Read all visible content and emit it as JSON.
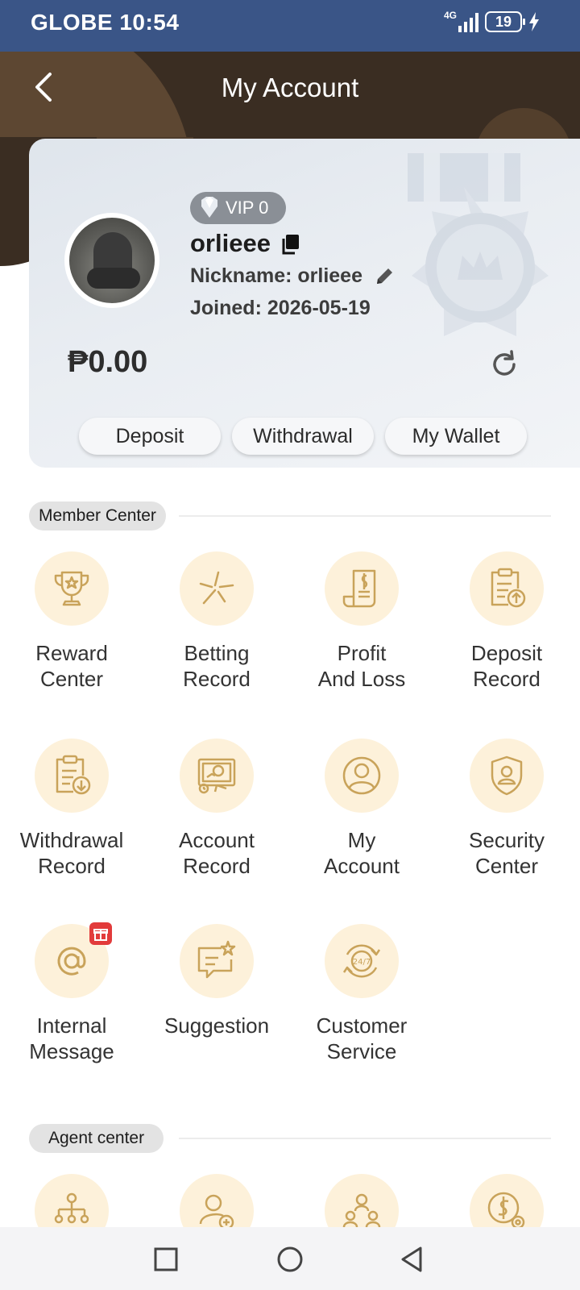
{
  "status_bar": {
    "carrier_time": "GLOBE 10:54",
    "network": "4G",
    "battery": "19"
  },
  "header": {
    "title": "My Account"
  },
  "profile": {
    "vip_label": "VIP 0",
    "username": "orlieee",
    "nickname": "Nickname: orlieee",
    "joined": "Joined: 2026-05-19",
    "balance": "₱0.00",
    "buttons": {
      "deposit": "Deposit",
      "withdrawal": "Withdrawal",
      "wallet": "My Wallet"
    }
  },
  "member_center": {
    "title": "Member Center",
    "items": [
      {
        "label": "Reward\nCenter",
        "icon": "trophy-icon"
      },
      {
        "label": "Betting\nRecord",
        "icon": "betting-icon"
      },
      {
        "label": "Profit\nAnd Loss",
        "icon": "receipt-dollar-icon"
      },
      {
        "label": "Deposit\nRecord",
        "icon": "clipboard-upload-icon"
      },
      {
        "label": "Withdrawal\nRecord",
        "icon": "clipboard-download-icon"
      },
      {
        "label": "Account\nRecord",
        "icon": "monitor-chart-icon"
      },
      {
        "label": "My\nAccount",
        "icon": "user-icon"
      },
      {
        "label": "Security\nCenter",
        "icon": "shield-user-icon"
      },
      {
        "label": "Internal\nMessage",
        "icon": "at-icon"
      },
      {
        "label": "Suggestion",
        "icon": "chat-star-icon"
      },
      {
        "label": "Customer\nService",
        "icon": "support-24-7-icon"
      }
    ]
  },
  "agent_center": {
    "title": "Agent center",
    "items": [
      {
        "icon": "org-chart-icon"
      },
      {
        "icon": "add-user-icon"
      },
      {
        "icon": "team-icon"
      },
      {
        "icon": "dollar-gear-icon"
      }
    ]
  },
  "colors": {
    "status_bar": "#3a5587",
    "header": "#3a2d22",
    "icon_bg": "#fdf1da",
    "icon_stroke": "#c9a35a"
  }
}
